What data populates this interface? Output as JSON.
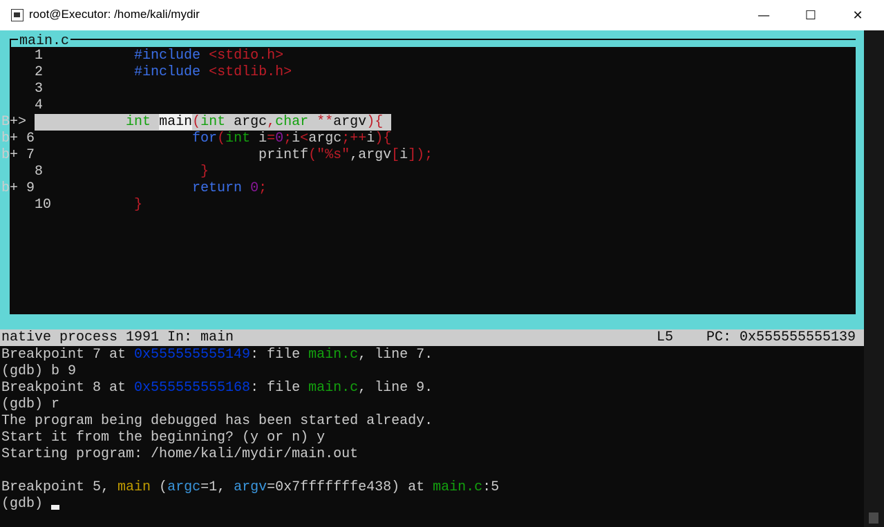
{
  "window": {
    "title": "root@Executor: /home/kali/mydir",
    "icon": "terminal-icon",
    "controls": [
      "minimize",
      "maximize",
      "close"
    ]
  },
  "colors": {
    "tui_border": "#62d6d6",
    "background": "#0c0c0c",
    "text": "#cccccc",
    "blue": "#3b6fe8",
    "red": "#c01c28",
    "green": "#13a10e",
    "purple": "#881798",
    "yellow": "#c19c00",
    "cyan_blue": "#3a96dd",
    "addr_blue": "#0037da"
  },
  "source": {
    "filename": "main.c",
    "lines": [
      [
        {
          "t": "    1           "
        },
        {
          "t": "#include ",
          "c": "blue"
        },
        {
          "t": "<stdio.h>",
          "c": "red"
        }
      ],
      [
        {
          "t": "    2           "
        },
        {
          "t": "#include ",
          "c": "blue"
        },
        {
          "t": "<stdlib.h>",
          "c": "red"
        }
      ],
      [
        {
          "t": "    3"
        }
      ],
      [
        {
          "t": "    4"
        }
      ],
      [
        {
          "t": "B+>"
        },
        {
          "t": "5           ",
          "c": "dark"
        },
        {
          "t": "int ",
          "c": "green"
        },
        {
          "t": "main",
          "c": "darkw"
        },
        {
          "t": "(",
          "c": "red"
        },
        {
          "t": "int ",
          "c": "green"
        },
        {
          "t": "argc",
          "c": "dark"
        },
        {
          "t": ",",
          "c": "red"
        },
        {
          "t": "char ",
          "c": "green"
        },
        {
          "t": "**",
          "c": "red"
        },
        {
          "t": "argv",
          "c": "dark"
        },
        {
          "t": "){",
          "c": "red"
        }
      ],
      [
        {
          "t": "b+ 6                   "
        },
        {
          "t": "for",
          "c": "blue"
        },
        {
          "t": "(",
          "c": "red"
        },
        {
          "t": "int ",
          "c": "green"
        },
        {
          "t": "i"
        },
        {
          "t": "=",
          "c": "red"
        },
        {
          "t": "0",
          "c": "purple"
        },
        {
          "t": ";",
          "c": "red"
        },
        {
          "t": "i"
        },
        {
          "t": "<",
          "c": "red"
        },
        {
          "t": "argc"
        },
        {
          "t": ";++",
          "c": "red"
        },
        {
          "t": "i"
        },
        {
          "t": "){",
          "c": "red"
        }
      ],
      [
        {
          "t": "b+ 7                           printf"
        },
        {
          "t": "(\"%s\"",
          "c": "red"
        },
        {
          "t": ",argv"
        },
        {
          "t": "[",
          "c": "red"
        },
        {
          "t": "i"
        },
        {
          "t": "]);",
          "c": "red"
        }
      ],
      [
        {
          "t": "    8                   "
        },
        {
          "t": "}",
          "c": "red"
        }
      ],
      [
        {
          "t": "b+ 9                   "
        },
        {
          "t": "return ",
          "c": "blue"
        },
        {
          "t": "0",
          "c": "purple"
        },
        {
          "t": ";",
          "c": "red"
        }
      ],
      [
        {
          "t": "    10          "
        },
        {
          "t": "}",
          "c": "red"
        }
      ]
    ]
  },
  "status_bar": {
    "process": "native process 1991 In: main",
    "line": "L5",
    "pc": "PC: 0x555555555139"
  },
  "console": [
    [
      {
        "t": "Breakpoint 7 at "
      },
      {
        "t": "0x555555555149",
        "c": "addr_blue"
      },
      {
        "t": ": file "
      },
      {
        "t": "main.c",
        "c": "green"
      },
      {
        "t": ", line 7."
      }
    ],
    [
      {
        "t": "(gdb) b 9"
      }
    ],
    [
      {
        "t": "Breakpoint 8 at "
      },
      {
        "t": "0x555555555168",
        "c": "addr_blue"
      },
      {
        "t": ": file "
      },
      {
        "t": "main.c",
        "c": "green"
      },
      {
        "t": ", line 9."
      }
    ],
    [
      {
        "t": "(gdb) r"
      }
    ],
    [
      {
        "t": "The program being debugged has been started already."
      }
    ],
    [
      {
        "t": "Start it from the beginning? (y or n) y"
      }
    ],
    [
      {
        "t": "Starting program: /home/kali/mydir/main.out"
      }
    ],
    [
      {
        "t": ""
      }
    ],
    [
      {
        "t": "Breakpoint 5, "
      },
      {
        "t": "main",
        "c": "yellow"
      },
      {
        "t": " ("
      },
      {
        "t": "argc",
        "c": "cyan_blue"
      },
      {
        "t": "=1, "
      },
      {
        "t": "argv",
        "c": "cyan_blue"
      },
      {
        "t": "=0x7fffffffe438) at "
      },
      {
        "t": "main.c",
        "c": "green"
      },
      {
        "t": ":5"
      }
    ],
    [
      {
        "t": "(gdb) "
      }
    ]
  ]
}
